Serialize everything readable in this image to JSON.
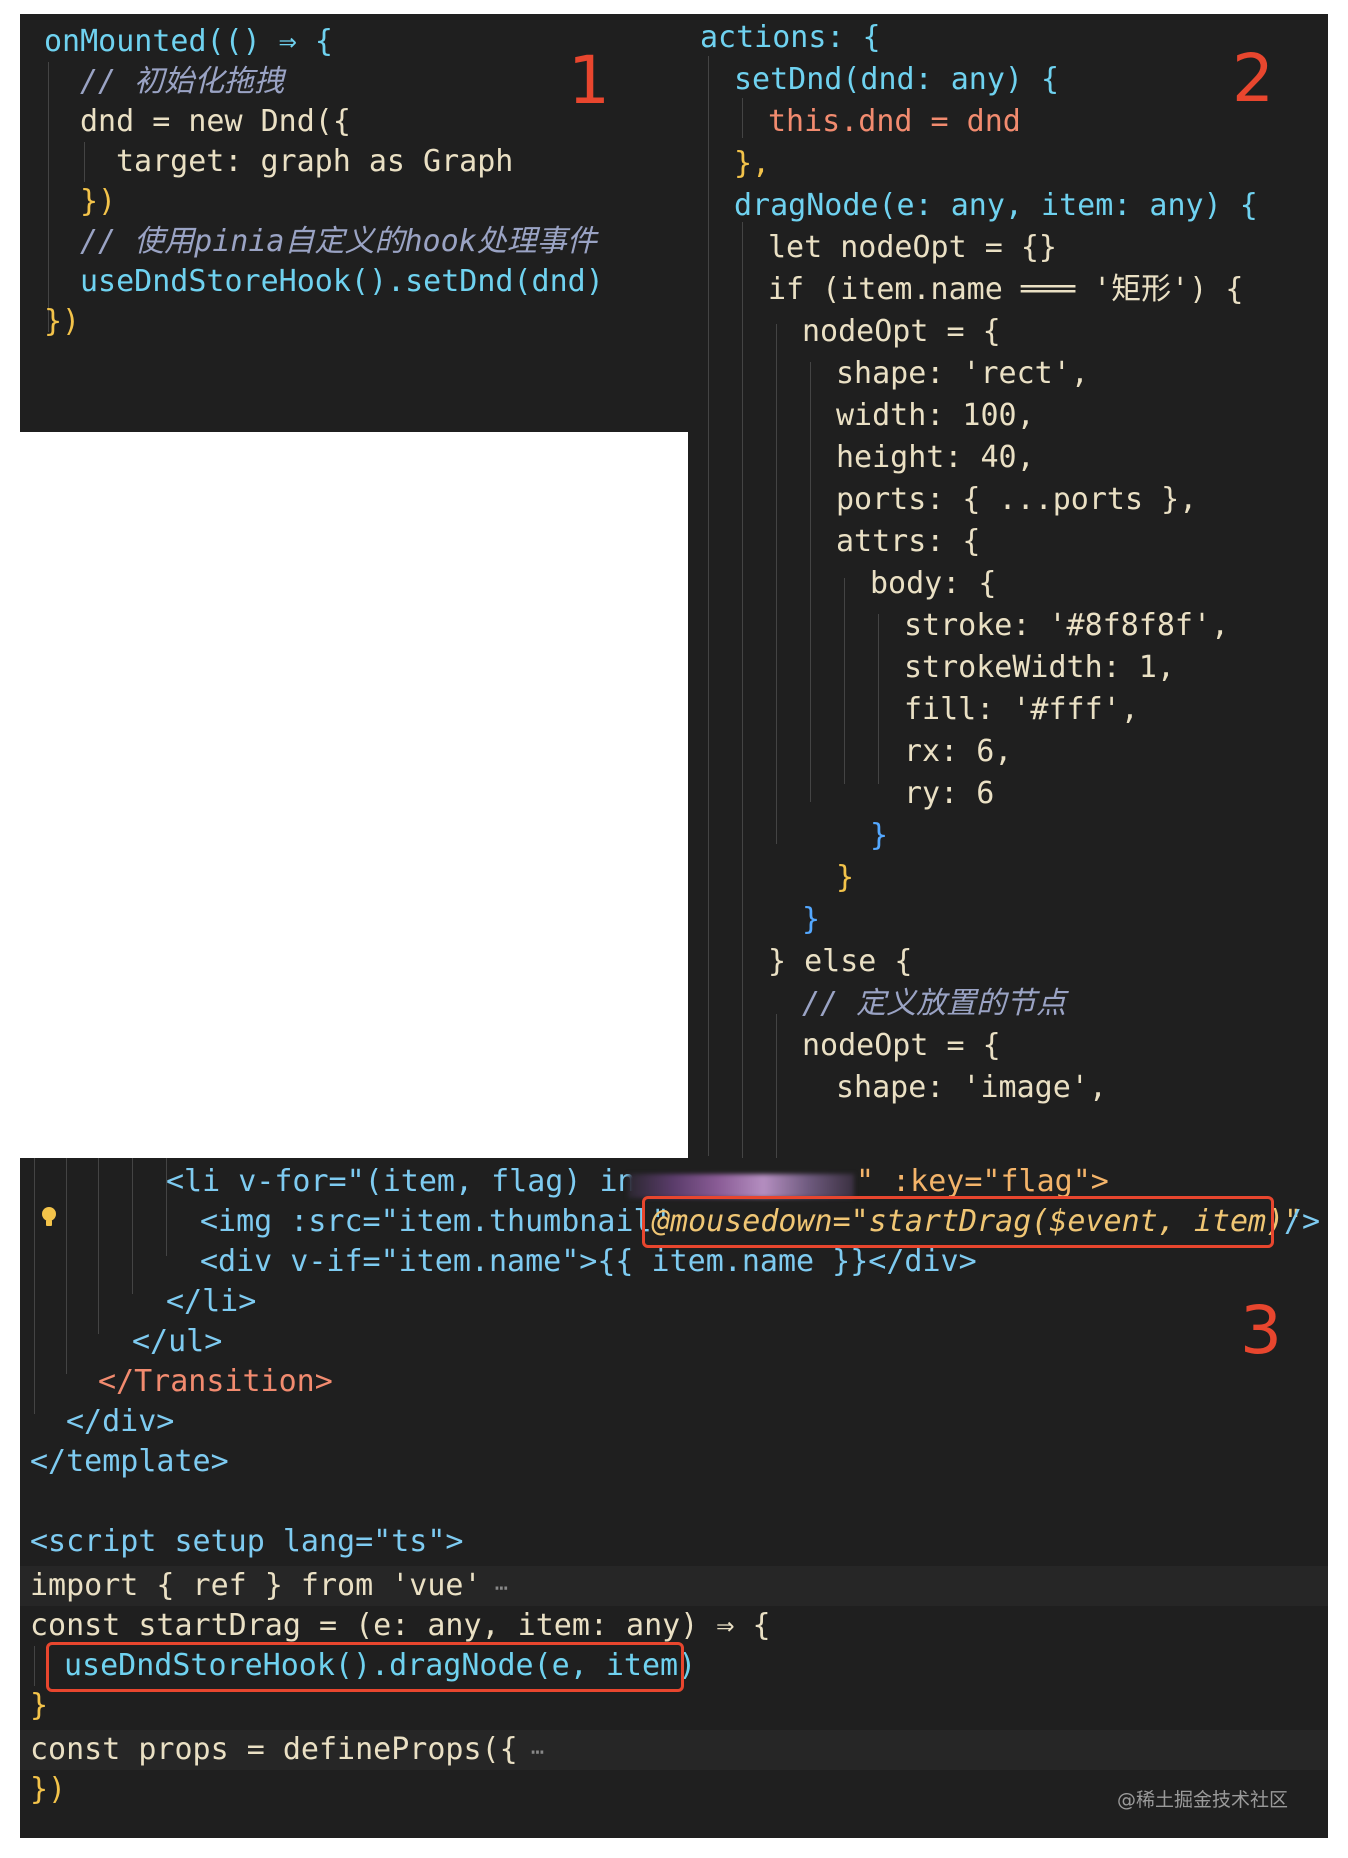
{
  "panel1": {
    "number": "1",
    "lines": [
      "onMounted(() ⇒ {",
      "// 初始化拖拽",
      "dnd = new Dnd({",
      "target: graph as Graph",
      "})",
      "// 使用pinia自定义的hook处理事件",
      "useDndStoreHook().setDnd(dnd)",
      "})"
    ]
  },
  "panel2": {
    "number": "2",
    "lines": [
      "actions: {",
      "setDnd(dnd: any) {",
      "this.dnd = dnd",
      "},",
      "dragNode(e: any, item: any) {",
      "let nodeOpt = {}",
      "if (item.name ═══ '矩形') {",
      "nodeOpt = {",
      "shape: 'rect',",
      "width: 100,",
      "height: 40,",
      "ports: { ...ports },",
      "attrs: {",
      "body: {",
      "stroke: '#8f8f8f',",
      "strokeWidth: 1,",
      "fill: '#fff',",
      "rx: 6,",
      "ry: 6",
      "}",
      "}",
      "}",
      "} else {",
      "// 定义放置的节点",
      "nodeOpt = {",
      "shape: 'image',"
    ]
  },
  "panel3": {
    "number": "3",
    "lines": [
      "<li v-for=\"(item, flag) in",
      "\" :key=\"flag\">",
      "<img :src=\"item.thumbnail\"",
      "@mousedown=\"startDrag($event, item)\"",
      "/>",
      "<div v-if=\"item.name\">{{ item.name }}</div>",
      "</li>",
      "</ul>",
      "</Transition>",
      "</div>",
      "</template>",
      "<script setup lang=\"ts\">",
      "import { ref } from 'vue'",
      "const startDrag = (e: any, item: any) ⇒ {",
      "useDndStoreHook().dragNode(e, item)",
      "}",
      "const props = defineProps({",
      "})"
    ]
  },
  "watermark": "@稀土掘金技术社区",
  "colors": {
    "background": "#1f1f1f",
    "annotation": "#e8462e",
    "keyword": "#f0c674",
    "function": "#6fd2f0",
    "string": "#f4b46a"
  },
  "icons": [
    "lightbulb-icon",
    "fold-ellipsis-icon"
  ]
}
